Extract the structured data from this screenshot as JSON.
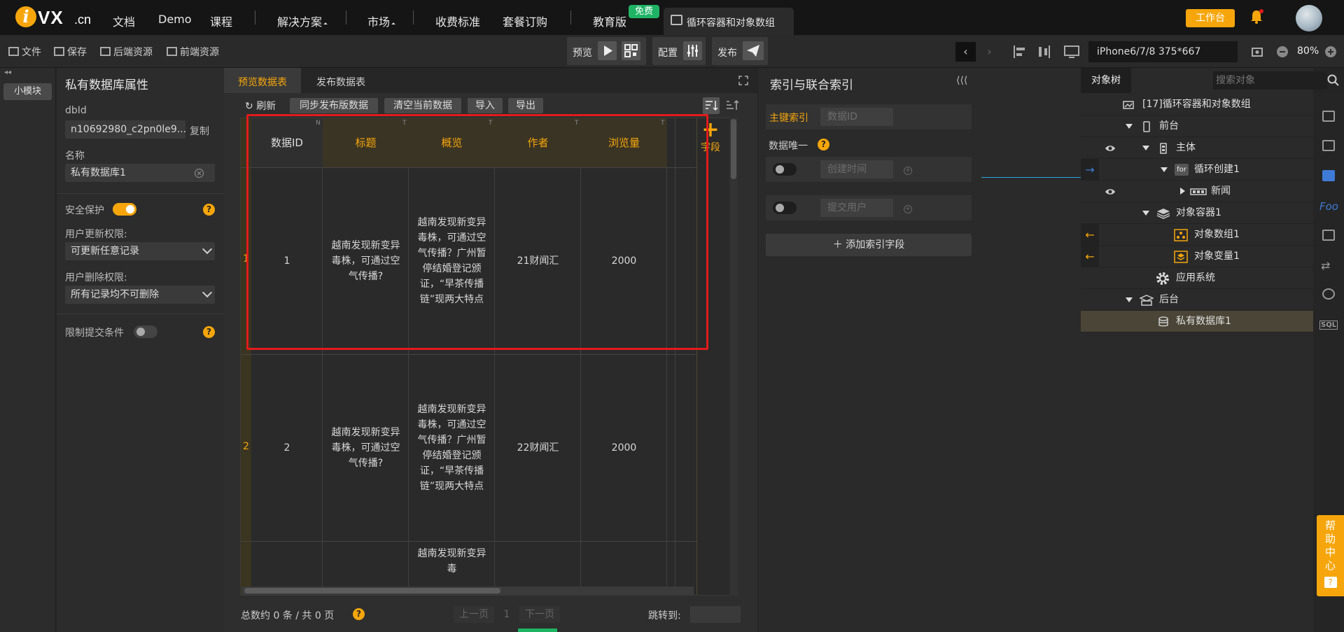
{
  "topnav": {
    "logo": "VX",
    "logo_suffix": ".cn",
    "links": [
      "文档",
      "Demo",
      "课程",
      "解决方案",
      "市场",
      "收费标准",
      "套餐订购",
      "教育版"
    ],
    "free_badge": "免费",
    "project_tab": "循环容器和对象数组",
    "workbench": "工作台"
  },
  "toolbar": {
    "file": "文件",
    "save": "保存",
    "backend_res": "后端资源",
    "frontend_res": "前端资源",
    "preview": "预览",
    "config": "配置",
    "publish": "发布",
    "device": "iPhone6/7/8 375*667",
    "zoom": "80%"
  },
  "leftstrip": {
    "small_module": "小模块"
  },
  "props": {
    "title": "私有数据库属性",
    "dbid_label": "dbId",
    "dbid_value": "n10692980_c2pn0le9...",
    "copy": "复制",
    "name_label": "名称",
    "name_value": "私有数据库1",
    "security_label": "安全保护",
    "update_label": "用户更新权限:",
    "update_value": "可更新任意记录",
    "delete_label": "用户删除权限:",
    "delete_value": "所有记录均不可删除",
    "limit_label": "限制提交条件"
  },
  "dbpanel": {
    "tab_preview": "预览数据表",
    "tab_publish": "发布数据表",
    "refresh": "刷新",
    "sync": "同步发布版数据",
    "clear": "清空当前数据",
    "import": "导入",
    "export": "导出",
    "add_field": "字段",
    "columns": [
      "数据ID",
      "标题",
      "概览",
      "作者",
      "浏览量"
    ],
    "column_types": [
      "N",
      "T",
      "T",
      "T",
      "T"
    ],
    "rows": [
      {
        "num": "1",
        "id": "1",
        "title": "越南发现新变异毒株，可通过空气传播?",
        "summary": "越南发现新变异毒株，可通过空气传播？广州暂停结婚登记颁证，“早茶传播链”现两大特点",
        "author": "21财闻汇",
        "views": "2000"
      },
      {
        "num": "2",
        "id": "2",
        "title": "越南发现新变异毒株，可通过空气传播?",
        "summary": "越南发现新变异毒株，可通过空气传播？广州暂停结婚登记颁证，“早茶传播链”现两大特点",
        "author": "22财闻汇",
        "views": "2000"
      },
      {
        "num": "",
        "id": "",
        "title": "",
        "summary": "越南发现新变异毒",
        "author": "",
        "views": ""
      }
    ],
    "footer_total": "总数约 0 条 / 共 0 页",
    "prev": "上一页",
    "page": "1",
    "next": "下一页",
    "jump": "跳转到:"
  },
  "idxpanel": {
    "title": "索引与联合索引",
    "primary": "主键索引",
    "primary_field": "数据ID",
    "unique": "数据唯一",
    "field1": "创建时间",
    "field2": "提交用户",
    "add": "添加索引字段"
  },
  "tree": {
    "tab": "对象树",
    "search_placeholder": "搜索对象",
    "items": [
      {
        "label": "[17]循环容器和对象数组"
      },
      {
        "label": "前台"
      },
      {
        "label": "主体"
      },
      {
        "label": "循环创建1"
      },
      {
        "label": "新闻"
      },
      {
        "label": "对象容器1"
      },
      {
        "label": "对象数组1"
      },
      {
        "label": "对象变量1"
      },
      {
        "label": "应用系统"
      },
      {
        "label": "后台"
      },
      {
        "label": "私有数据库1"
      }
    ]
  },
  "help_center": "帮助中心",
  "colors": {
    "accent": "#f6a60c",
    "highlight_box": "#e21b1b",
    "free_badge": "#1fb465"
  }
}
